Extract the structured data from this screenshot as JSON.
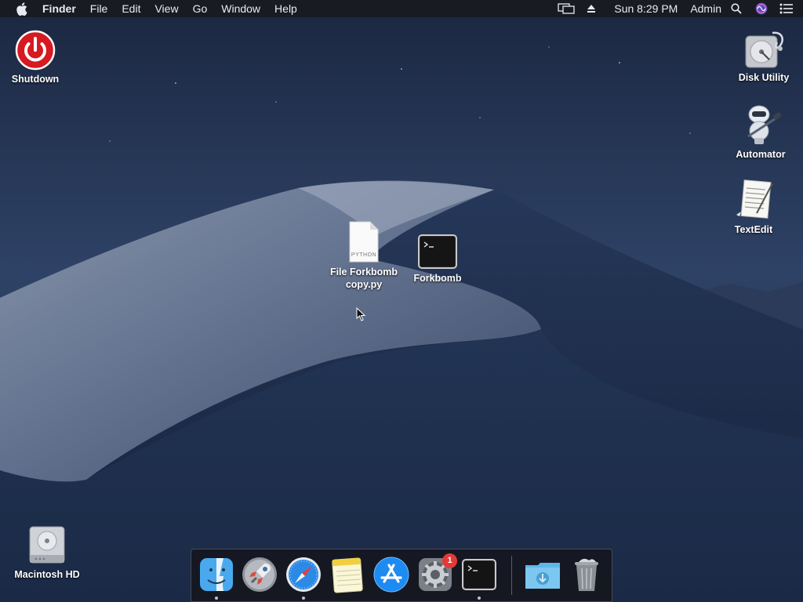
{
  "menubar": {
    "items": [
      "Finder",
      "File",
      "Edit",
      "View",
      "Go",
      "Window",
      "Help"
    ],
    "clock": "Sun 8:29 PM",
    "user": "Admin"
  },
  "desktop": {
    "shutdown": "Shutdown",
    "disk_utility": "Disk Utility",
    "automator": "Automator",
    "textedit": "TextEdit",
    "python_file": "File Forkbomb copy.py",
    "python_tag": "PYTHON",
    "forkbomb": "Forkbomb",
    "macintosh_hd": "Macintosh HD"
  },
  "dock": {
    "apps": [
      "Finder",
      "Launchpad",
      "Safari",
      "Notes",
      "App Store",
      "System Preferences",
      "Terminal",
      "Downloads",
      "Trash"
    ],
    "running": [
      "Finder",
      "Safari",
      "Terminal"
    ],
    "system_prefs_badge": "1"
  },
  "colors": {
    "menubar": "#181a20",
    "shutdown_red": "#d71921",
    "badge_red": "#e53935"
  }
}
